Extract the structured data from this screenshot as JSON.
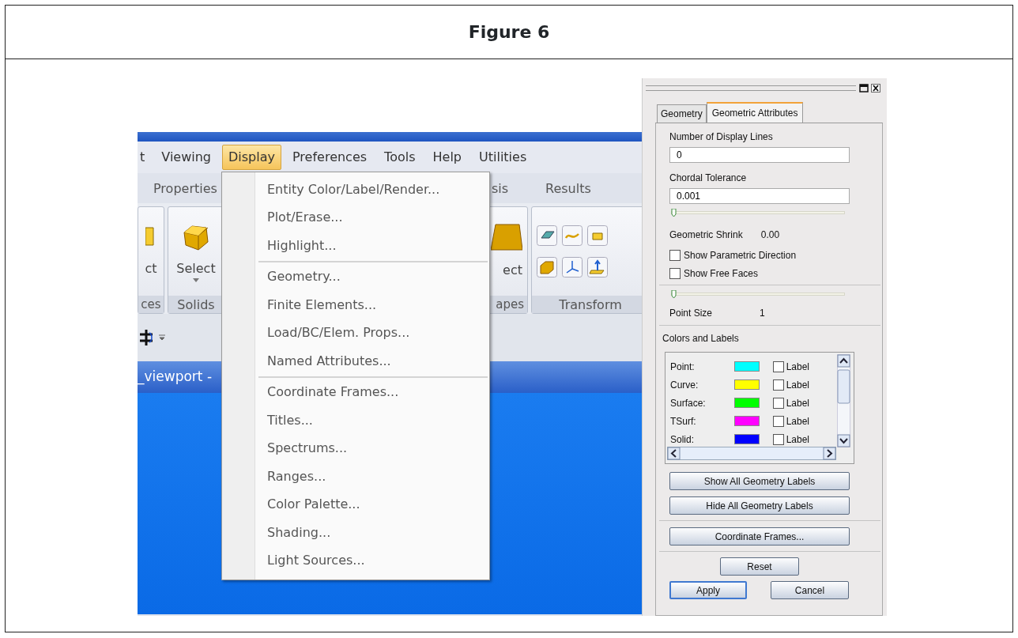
{
  "figure": {
    "title": "Figure 6"
  },
  "menu_bar": {
    "items": [
      {
        "label": "t",
        "selected": false
      },
      {
        "label": "Viewing",
        "selected": false
      },
      {
        "label": "Display",
        "selected": true
      },
      {
        "label": "Preferences",
        "selected": false
      },
      {
        "label": "Tools",
        "selected": false
      },
      {
        "label": "Help",
        "selected": false
      },
      {
        "label": "Utilities",
        "selected": false
      }
    ]
  },
  "ribbon_tabs": [
    {
      "label": "Properties"
    },
    {
      "label": "sis"
    },
    {
      "label": "Results"
    }
  ],
  "ribbon_groups": [
    {
      "kind": "partial",
      "button": "ct",
      "title": "ces"
    },
    {
      "kind": "select",
      "button": "Select",
      "title": "Solids"
    },
    {
      "kind": "shape",
      "button": "ect",
      "title": "apes"
    },
    {
      "kind": "tools",
      "title": "Transform"
    }
  ],
  "viewport": {
    "title": "_viewport -"
  },
  "display_menu": {
    "groups": [
      [
        "Entity Color/Label/Render...",
        "Plot/Erase...",
        "Highlight..."
      ],
      [
        "Geometry...",
        "Finite Elements...",
        "Load/BC/Elem. Props...",
        "Named Attributes..."
      ],
      [
        "Coordinate Frames...",
        "Titles...",
        "Spectrums...",
        "Ranges...",
        "Color Palette...",
        "Shading...",
        "Light Sources..."
      ]
    ]
  },
  "panel": {
    "tabs": [
      {
        "label": "Geometry",
        "selected": false
      },
      {
        "label": "Geometric Attributes",
        "selected": true
      }
    ],
    "display_lines": {
      "label": "Number of Display Lines",
      "value": "0"
    },
    "chordal_tolerance": {
      "label": "Chordal Tolerance",
      "value": "0.001"
    },
    "shrink_slider": {
      "level": 0
    },
    "geometric_shrink": {
      "label": "Geometric Shrink",
      "value": "0.00"
    },
    "checkboxes": [
      {
        "label": "Show Parametric Direction",
        "checked": false
      },
      {
        "label": "Show Free Faces",
        "checked": false
      }
    ],
    "point_size_slider": {
      "level": 0
    },
    "point_size": {
      "label": "Point Size",
      "value": "1"
    },
    "colors": {
      "title": "Colors and Labels",
      "rows": [
        {
          "name": "Point:",
          "color": "#00ffff",
          "label": "Label",
          "checked": false
        },
        {
          "name": "Curve:",
          "color": "#ffff00",
          "label": "Label",
          "checked": false
        },
        {
          "name": "Surface:",
          "color": "#00ff00",
          "label": "Label",
          "checked": false
        },
        {
          "name": "TSurf:",
          "color": "#ff00ff",
          "label": "Label",
          "checked": false
        },
        {
          "name": "Solid:",
          "color": "#0000ff",
          "label": "Label",
          "checked": false
        }
      ]
    },
    "label_buttons": [
      "Show All Geometry Labels",
      "Hide All Geometry Labels"
    ],
    "frames_button": "Coordinate Frames...",
    "reset_button": "Reset",
    "buttons": [
      {
        "label": "Apply",
        "default": true
      },
      {
        "label": "Cancel",
        "default": false
      }
    ]
  }
}
